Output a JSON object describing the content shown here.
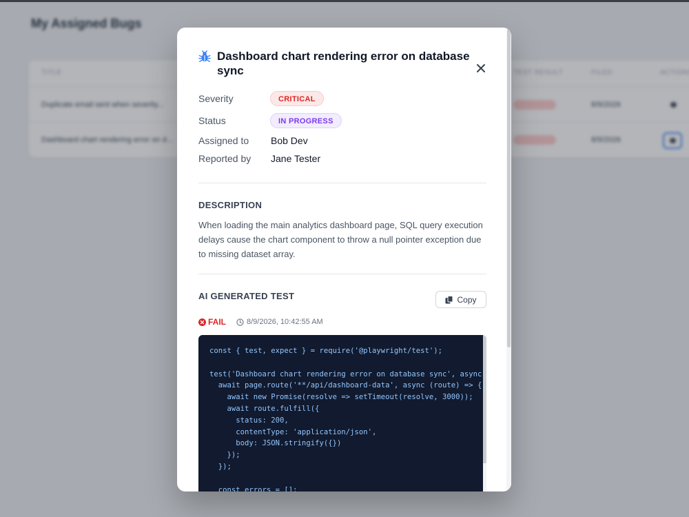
{
  "background": {
    "page_title": "My Assigned Bugs",
    "columns": [
      "Title",
      "Test Result",
      "Filed",
      "Actions"
    ],
    "rows": [
      {
        "title": "Duplicate email sent when severity...",
        "filed": "8/9/2026"
      },
      {
        "title": "Dashboard chart rendering error on d...",
        "filed": "8/9/2026"
      }
    ]
  },
  "modal": {
    "title": "Dashboard chart rendering error on database sync",
    "fields": {
      "severity_label": "Severity",
      "severity_value": "CRITICAL",
      "status_label": "Status",
      "status_value": "IN PROGRESS",
      "assigned_label": "Assigned to",
      "assigned_value": "Bob Dev",
      "reported_label": "Reported by",
      "reported_value": "Jane Tester"
    },
    "description_heading": "DESCRIPTION",
    "description": "When loading the main analytics dashboard page, SQL query execution delays cause the chart component to throw a null pointer exception due to missing dataset array.",
    "test_heading": "AI GENERATED TEST",
    "copy_label": "Copy",
    "result": "FAIL",
    "timestamp": "8/9/2026, 10:42:55 AM",
    "code": "const { test, expect } = require('@playwright/test');\n\ntest('Dashboard chart rendering error on database sync', async ({ page }) => {\n  await page.route('**/api/dashboard-data', async (route) => {\n    await new Promise(resolve => setTimeout(resolve, 3000));\n    await route.fulfill({\n      status: 200,\n      contentType: 'application/json',\n      body: JSON.stringify({})\n    });\n  });\n\n  const errors = [];"
  },
  "colors": {
    "critical": "#dc2626",
    "in_progress": "#7c3aed",
    "accent_icon": "#3b82f6",
    "code_bg": "#111a2e"
  },
  "icons": [
    "bug-icon",
    "close-icon",
    "copy-icon",
    "fail-x-icon",
    "clock-icon",
    "eye-icon"
  ]
}
